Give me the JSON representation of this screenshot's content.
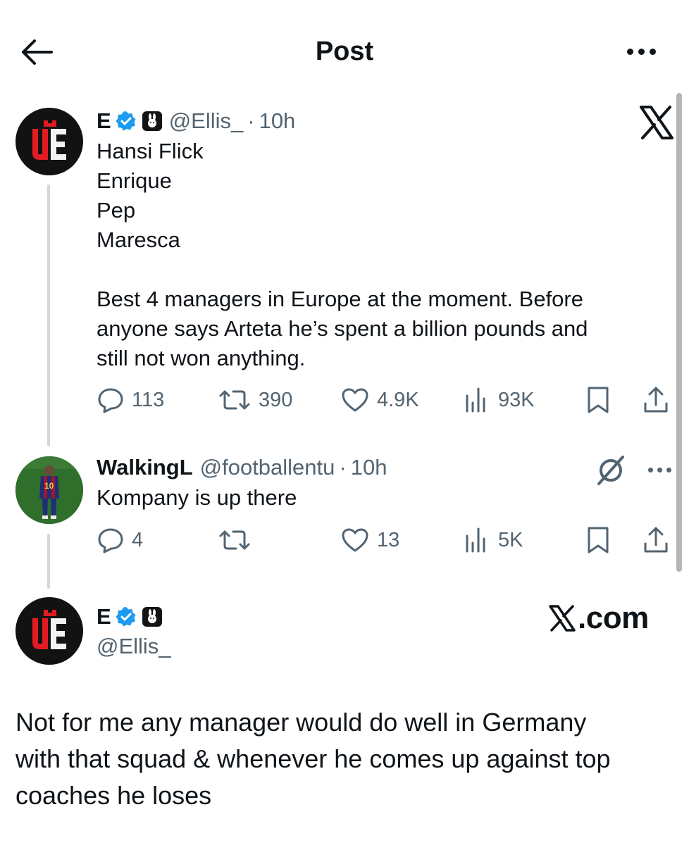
{
  "header": {
    "title": "Post",
    "back_icon": "arrow-left-icon",
    "more_icon": "more-horizontal-icon"
  },
  "colors": {
    "text": "#0f1419",
    "muted": "#536471",
    "verified": "#1d9bf0",
    "thread_line": "#cfd9de"
  },
  "main_post": {
    "name": "E",
    "handle": "@Ellis_",
    "separator": "·",
    "time": "10h",
    "lines": [
      "Hansi Flick",
      "Enrique",
      "Pep",
      "Maresca",
      "",
      "Best 4 managers in Europe at the moment. Before",
      "anyone says Arteta he’s spent a billion pounds and",
      "still not won anything."
    ],
    "actions": {
      "replies": "113",
      "reposts": "390",
      "likes": "4.9K",
      "views": "93K"
    }
  },
  "reply": {
    "name": "WalkingL",
    "handle": "@footballentu",
    "separator": "·",
    "time": "10h",
    "text": "Kompany is up there",
    "actions": {
      "replies": "4",
      "reposts": "",
      "likes": "13",
      "views": "5K"
    }
  },
  "quote": {
    "name": "E",
    "handle": "@Ellis_",
    "watermark": ".com",
    "lines": [
      "Not for me any manager would do well in Germany",
      "with that squad & whenever he comes up against top",
      "coaches he loses"
    ]
  }
}
